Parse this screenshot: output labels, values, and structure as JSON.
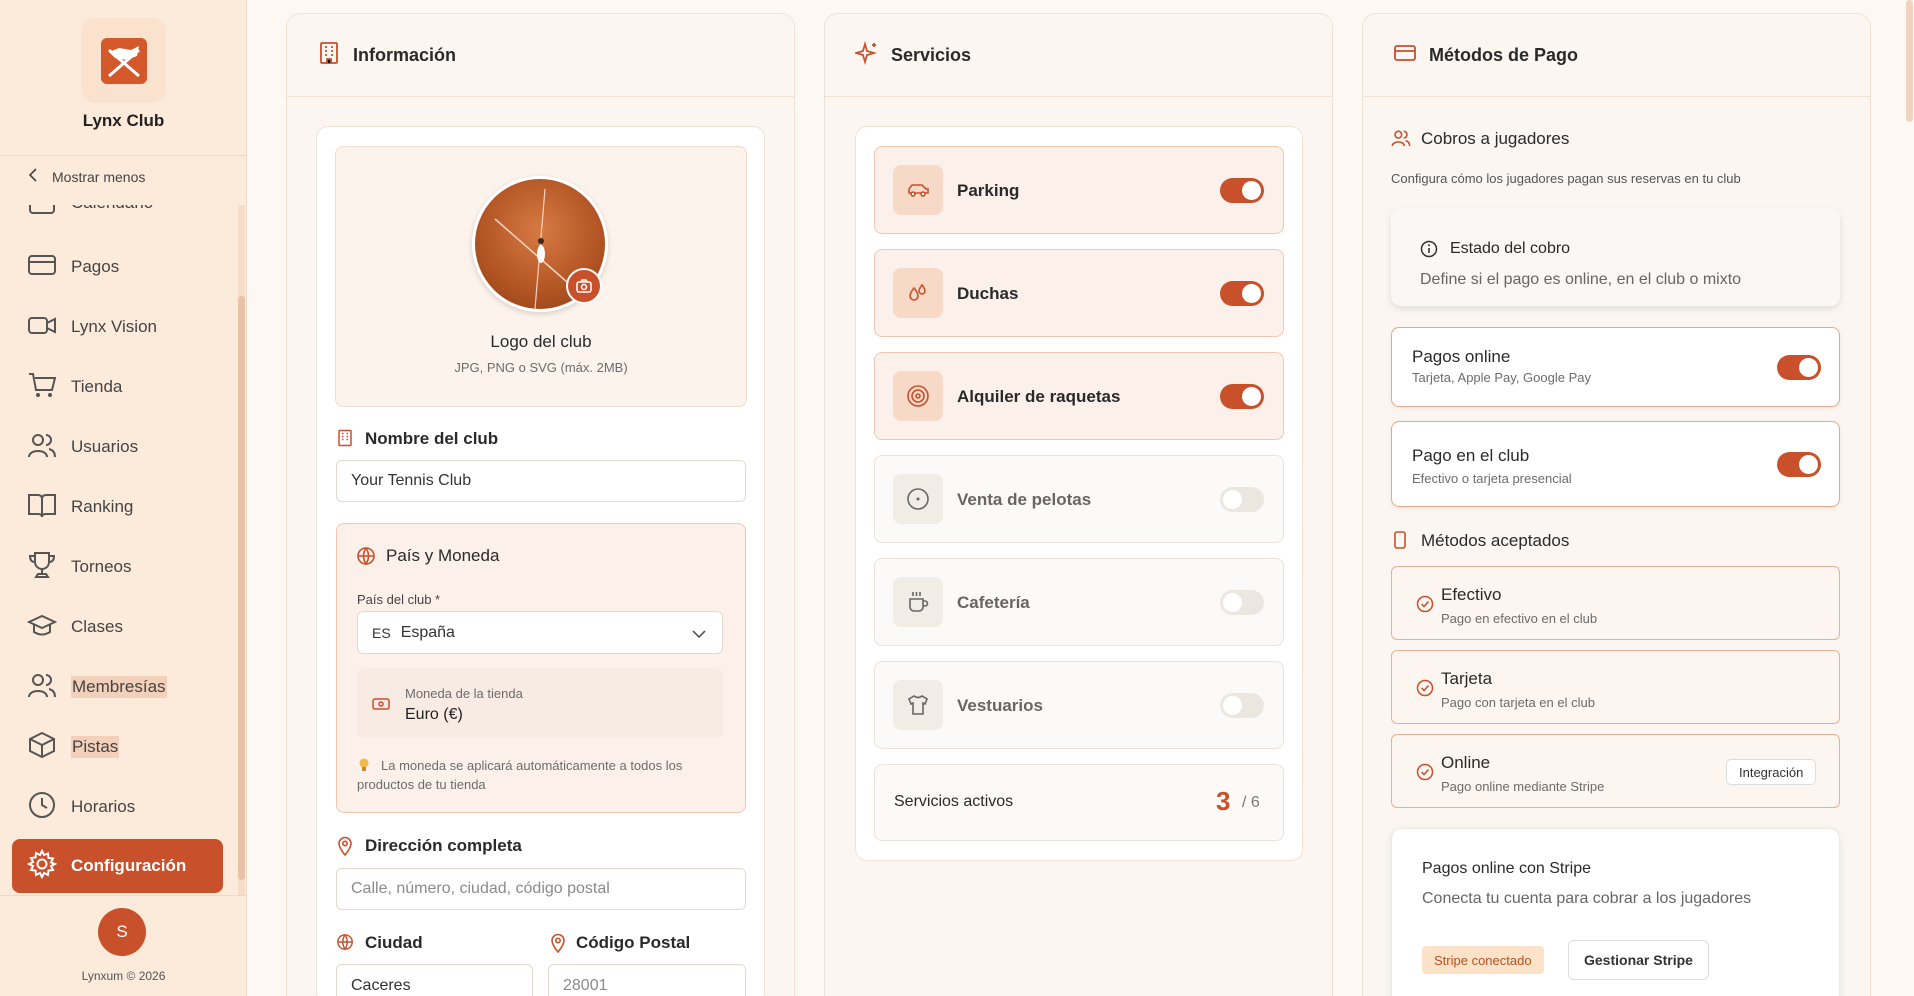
{
  "sidebar": {
    "brand": "Lynx Club",
    "collapse_label": "Mostrar menos",
    "items": [
      {
        "label": "Calendario"
      },
      {
        "label": "Pagos"
      },
      {
        "label": "Lynx Vision"
      },
      {
        "label": "Tienda"
      },
      {
        "label": "Usuarios"
      },
      {
        "label": "Ranking"
      },
      {
        "label": "Torneos"
      },
      {
        "label": "Clases"
      },
      {
        "label": "Membresías"
      },
      {
        "label": "Pistas"
      },
      {
        "label": "Horarios"
      },
      {
        "label": "Configuración"
      }
    ],
    "avatar_initial": "S",
    "copyright": "Lynxum © 2026"
  },
  "info": {
    "title": "Información",
    "logo_title": "Logo del club",
    "logo_hint": "JPG, PNG o SVG (máx. 2MB)",
    "name_label": "Nombre del club",
    "name_value": "Your Tennis Club",
    "country_section": "País y Moneda",
    "country_label": "País del club *",
    "country_code": "ES",
    "country_value": "España",
    "currency_label": "Moneda de la tienda",
    "currency_value": "Euro (€)",
    "currency_note_line1": "La moneda se aplicará automáticamente a todos los",
    "currency_note_line2": "productos de tu tienda",
    "address_label": "Dirección completa",
    "address_placeholder": "Calle, número, ciudad, código postal",
    "city_label": "Ciudad",
    "city_value": "Caceres",
    "postal_label": "Código Postal",
    "postal_placeholder": "28001"
  },
  "services": {
    "title": "Servicios",
    "items": [
      {
        "label": "Parking",
        "enabled": true,
        "icon": "car-icon"
      },
      {
        "label": "Duchas",
        "enabled": true,
        "icon": "droplets-icon"
      },
      {
        "label": "Alquiler de raquetas",
        "enabled": true,
        "icon": "target-icon"
      },
      {
        "label": "Venta de pelotas",
        "enabled": false,
        "icon": "ball-icon"
      },
      {
        "label": "Cafetería",
        "enabled": false,
        "icon": "coffee-icon"
      },
      {
        "label": "Vestuarios",
        "enabled": false,
        "icon": "shirt-icon"
      }
    ],
    "active_label": "Servicios activos",
    "active_count": "3",
    "total": "/ 6"
  },
  "payments": {
    "title": "Métodos de Pago",
    "collect_title": "Cobros a jugadores",
    "collect_desc": "Configura cómo los jugadores pagan sus reservas en tu club",
    "status_title": "Estado del cobro",
    "status_desc": "Define si el pago es online, en el club o mixto",
    "online_title": "Pagos online",
    "online_desc": "Tarjeta, Apple Pay, Google Pay",
    "club_title": "Pago en el club",
    "club_desc": "Efectivo o tarjeta presencial",
    "accepted_title": "Métodos aceptados",
    "methods": [
      {
        "title": "Efectivo",
        "desc": "Pago en efectivo en el club"
      },
      {
        "title": "Tarjeta",
        "desc": "Pago con tarjeta en el club"
      },
      {
        "title": "Online",
        "desc": "Pago online mediante Stripe",
        "badge": "Integración"
      }
    ],
    "stripe_title": "Pagos online con Stripe",
    "stripe_desc": "Conecta tu cuenta para cobrar a los jugadores",
    "stripe_status": "Stripe conectado",
    "stripe_manage": "Gestionar Stripe"
  },
  "colors": {
    "accent": "#c8502a",
    "sidebar_bg": "#fcebdb",
    "page_bg": "#fdf8f4"
  }
}
